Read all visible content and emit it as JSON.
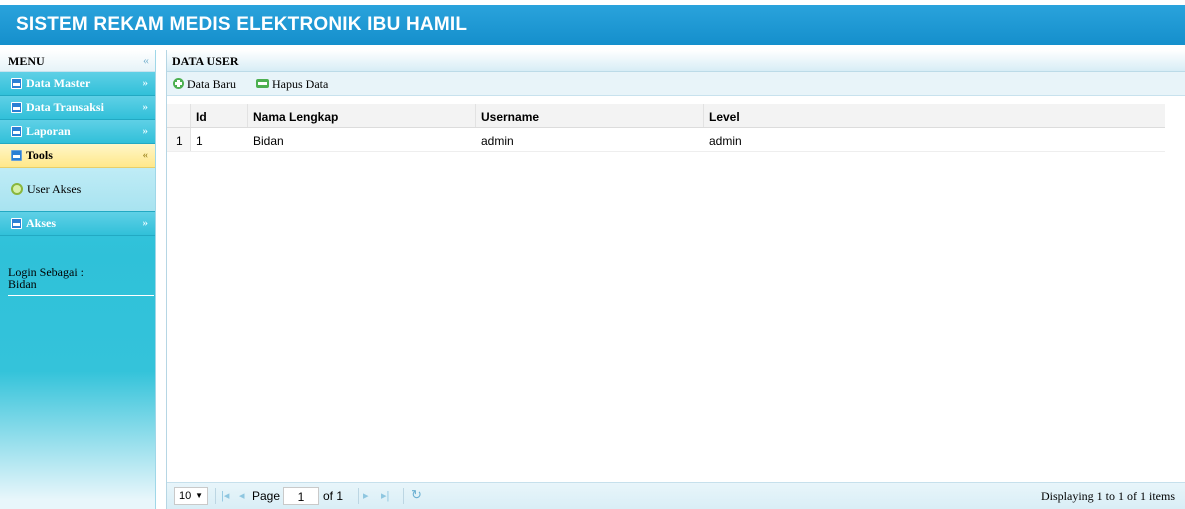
{
  "app": {
    "title": "SISTEM REKAM MEDIS ELEKTRONIK IBU HAMIL"
  },
  "sidebar": {
    "header": "MENU",
    "collapse_icon": "double-chevron-left-icon",
    "items": [
      {
        "label": "Data Master",
        "state": "collapsed"
      },
      {
        "label": "Data Transaksi",
        "state": "collapsed"
      },
      {
        "label": "Laporan",
        "state": "collapsed"
      },
      {
        "label": "Tools",
        "state": "expanded"
      },
      {
        "label": "Akses",
        "state": "collapsed"
      }
    ],
    "tools_submenu": [
      {
        "label": "User Akses",
        "icon": "gear-icon"
      }
    ],
    "login_label": "Login Sebagai :",
    "login_user": "Bidan"
  },
  "main": {
    "title": "DATA USER",
    "toolbar": {
      "add_label": "Data Baru",
      "delete_label": "Hapus Data"
    },
    "grid": {
      "columns": [
        "Id",
        "Nama Lengkap",
        "Username",
        "Level"
      ],
      "rows": [
        {
          "rownum": "1",
          "id": "1",
          "nama": "Bidan",
          "username": "admin",
          "level": "admin"
        }
      ]
    },
    "pager": {
      "page_size": "10",
      "page_label": "Page",
      "page_value": "1",
      "of_label": "of 1",
      "display_text": "Displaying 1 to 1 of 1 items"
    }
  },
  "colors": {
    "header_bg": "#1b97d3",
    "sidebar_bg": "#2fc1d9",
    "active_item_bg": "#ffe88a",
    "icon_green": "#4caf50"
  }
}
